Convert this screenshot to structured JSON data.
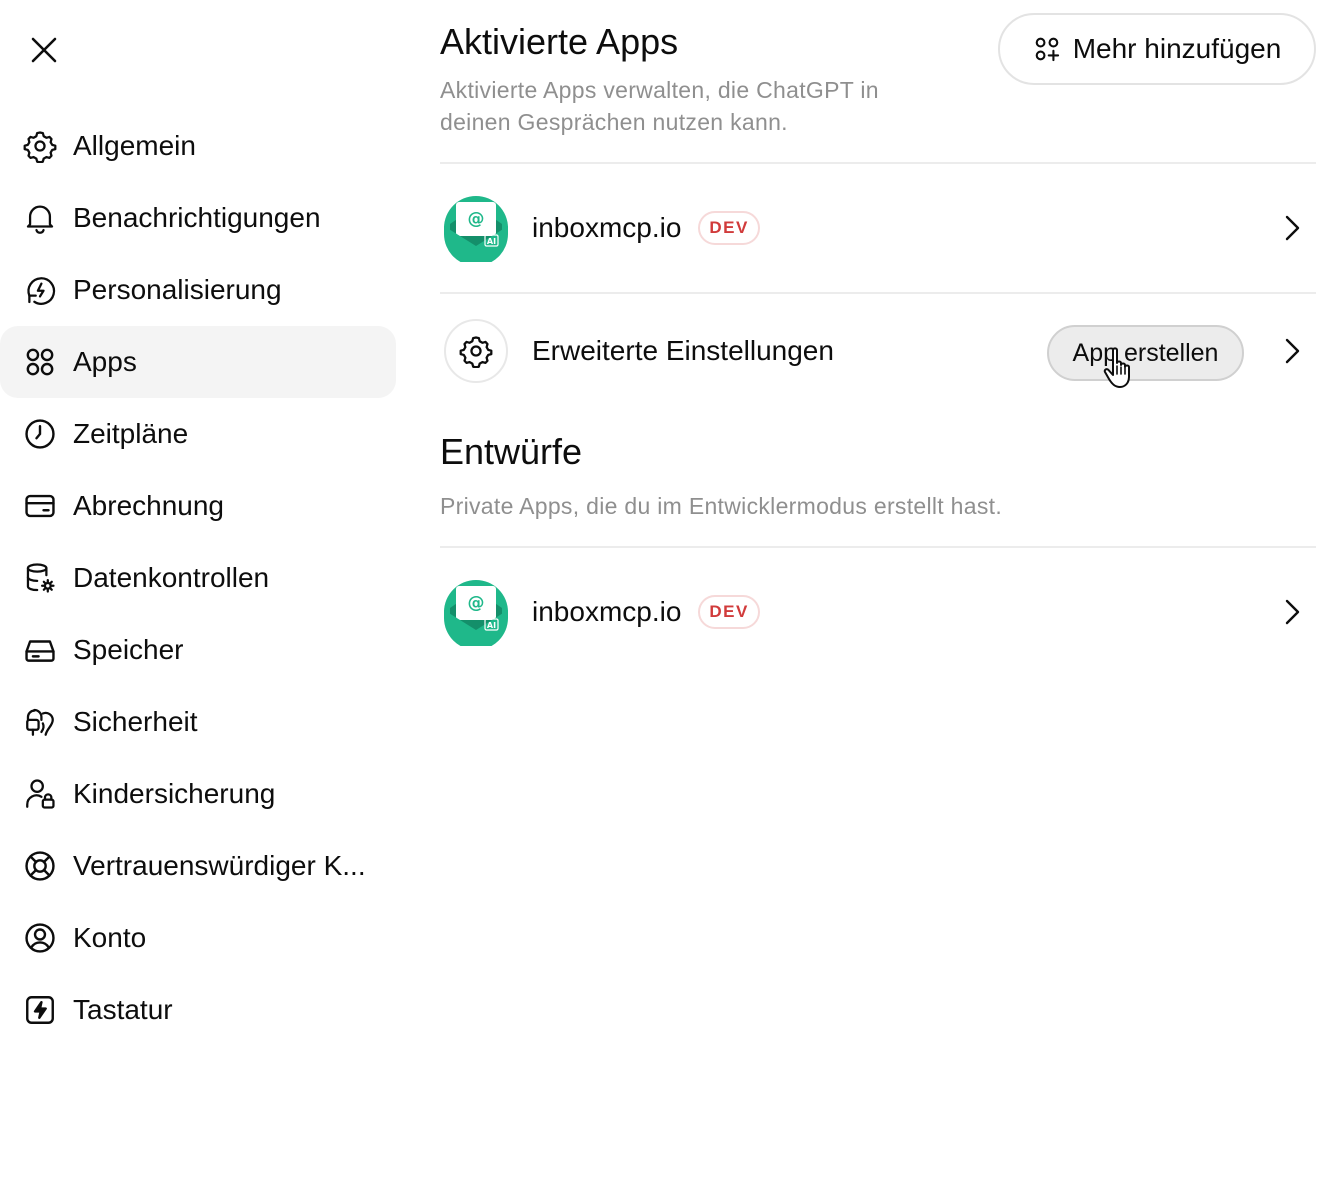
{
  "close_label": "Schließen",
  "sidebar": {
    "items": [
      {
        "label": "Allgemein",
        "icon": "gear-icon"
      },
      {
        "label": "Benachrichtigungen",
        "icon": "bell-icon"
      },
      {
        "label": "Personalisierung",
        "icon": "clock-arrow-icon"
      },
      {
        "label": "Apps",
        "icon": "apps-grid-icon",
        "active": true
      },
      {
        "label": "Zeitpläne",
        "icon": "clock-icon"
      },
      {
        "label": "Abrechnung",
        "icon": "credit-card-icon"
      },
      {
        "label": "Datenkontrollen",
        "icon": "database-gear-icon"
      },
      {
        "label": "Speicher",
        "icon": "storage-drive-icon"
      },
      {
        "label": "Sicherheit",
        "icon": "security-lock-icon"
      },
      {
        "label": "Kindersicherung",
        "icon": "person-lock-icon"
      },
      {
        "label": "Vertrauenswürdiger K...",
        "icon": "lifebuoy-icon"
      },
      {
        "label": "Konto",
        "icon": "user-circle-icon"
      },
      {
        "label": "Tastatur",
        "icon": "keyboard-bolt-icon"
      }
    ]
  },
  "enabled": {
    "title": "Aktivierte Apps",
    "subtitle_line1": "Aktivierte Apps verwalten, die ChatGPT in",
    "subtitle_line2": "deinen Gesprächen nutzen kann.",
    "add_button": "Mehr hinzufügen",
    "apps": [
      {
        "name": "inboxmcp.io",
        "badge": "DEV",
        "icon_mark": "@",
        "icon_tag": "AI"
      }
    ],
    "advanced": {
      "label": "Erweiterte Einstellungen",
      "create_button": "App erstellen"
    }
  },
  "drafts": {
    "title": "Entwürfe",
    "subtitle": "Private Apps, die du im Entwicklermodus erstellt hast.",
    "apps": [
      {
        "name": "inboxmcp.io",
        "badge": "DEV",
        "icon_mark": "@",
        "icon_tag": "AI"
      }
    ]
  },
  "colors": {
    "accent_green": "#1fb88a",
    "dev_badge_text": "#d13b3b",
    "dev_badge_border": "#f6d9d9",
    "active_nav_bg": "#f4f4f4",
    "muted_text": "#8f8f8f"
  }
}
